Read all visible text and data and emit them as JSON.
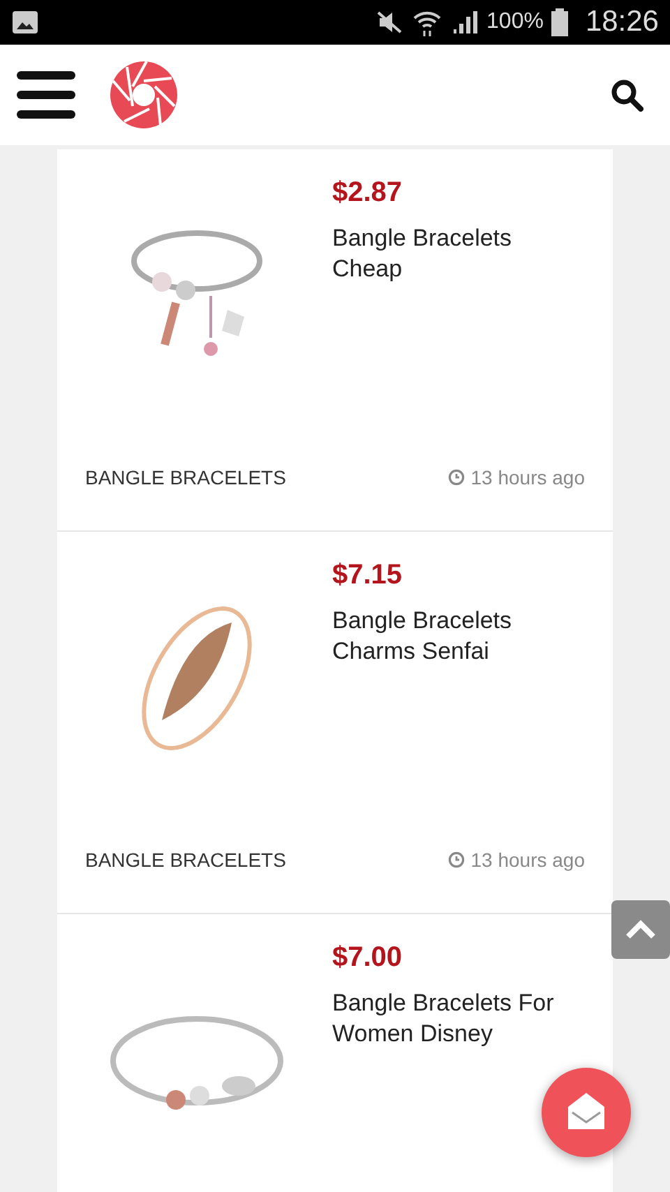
{
  "status_bar": {
    "battery": "100%",
    "time": "18:26"
  },
  "products": [
    {
      "price": "$2.87",
      "title": "Bangle Bracelets Cheap",
      "category": "BANGLE BRACELETS",
      "time": "13 hours ago"
    },
    {
      "price": "$7.15",
      "title": "Bangle Bracelets Charms Senfai",
      "category": "BANGLE BRACELETS",
      "time": "13 hours ago"
    },
    {
      "price": "$7.00",
      "title": "Bangle Bracelets For Women Disney"
    }
  ]
}
